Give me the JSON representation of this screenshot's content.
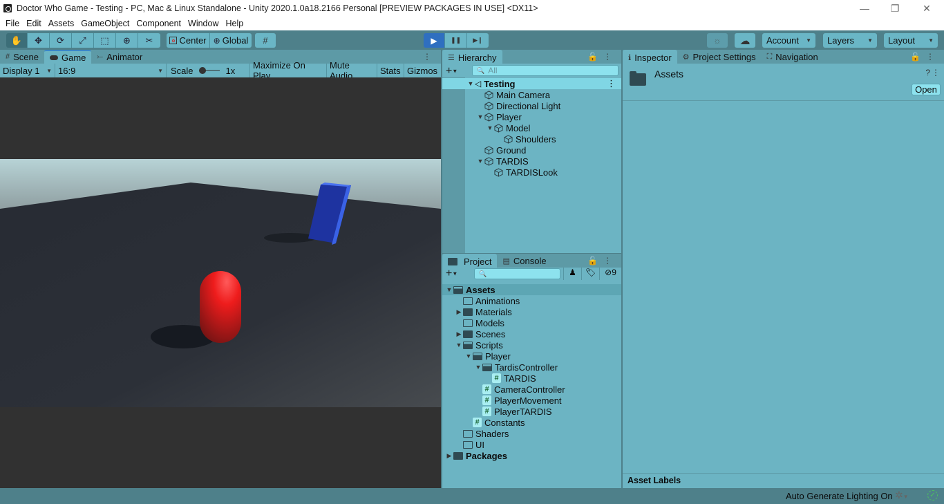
{
  "window": {
    "title": "Doctor Who Game - Testing - PC, Mac & Linux Standalone - Unity 2020.1.0a18.2166 Personal [PREVIEW PACKAGES IN USE] <DX11>",
    "controls": {
      "minimize": "—",
      "restore": "❐",
      "close": "✕"
    }
  },
  "menu": [
    "File",
    "Edit",
    "Assets",
    "GameObject",
    "Component",
    "Window",
    "Help"
  ],
  "toolbar": {
    "tools": [
      {
        "name": "hand-tool",
        "glyph": "✋"
      },
      {
        "name": "move-tool",
        "glyph": "✥"
      },
      {
        "name": "rotate-tool",
        "glyph": "⟳"
      },
      {
        "name": "scale-tool",
        "glyph": "⤢"
      },
      {
        "name": "rect-tool",
        "glyph": "⬚"
      },
      {
        "name": "transform-tool",
        "glyph": "⊕"
      },
      {
        "name": "custom-tool",
        "glyph": "✂"
      }
    ],
    "pivot_mode": "Center",
    "pivot_rotation": "Global",
    "snap_glyph": "#",
    "play_glyph": "▶",
    "pause_glyph": "❚❚",
    "step_glyph": "▶❙",
    "collab_glyph": "☼",
    "cloud_glyph": "☁",
    "account": "Account",
    "layers": "Layers",
    "layout": "Layout"
  },
  "scene_panel": {
    "tabs": [
      {
        "label": "Scene",
        "glyph": "#"
      },
      {
        "label": "Game",
        "glyph": "🎮"
      },
      {
        "label": "Animator",
        "glyph": "⤚"
      }
    ],
    "active_tab": "Game",
    "display": "Display 1",
    "aspect": "16:9",
    "scale_label": "Scale",
    "scale_value": "1x",
    "maximize_on_play": "Maximize On Play",
    "mute_audio": "Mute Audio",
    "stats": "Stats",
    "gizmos": "Gizmos"
  },
  "hierarchy": {
    "tab": "Hierarchy",
    "search_placeholder": "All",
    "scene": "Testing",
    "items": [
      {
        "label": "Main Camera",
        "depth": 1,
        "expanded": null
      },
      {
        "label": "Directional Light",
        "depth": 1,
        "expanded": null
      },
      {
        "label": "Player",
        "depth": 1,
        "expanded": true
      },
      {
        "label": "Model",
        "depth": 2,
        "expanded": true
      },
      {
        "label": "Shoulders",
        "depth": 3,
        "expanded": null
      },
      {
        "label": "Ground",
        "depth": 1,
        "expanded": null
      },
      {
        "label": "TARDIS",
        "depth": 1,
        "expanded": true
      },
      {
        "label": "TARDISLook",
        "depth": 2,
        "expanded": null
      }
    ]
  },
  "project": {
    "tabs": [
      "Project",
      "Console"
    ],
    "active_tab": "Project",
    "hidden_count": "9",
    "items": [
      {
        "label": "Assets",
        "depth": 0,
        "type": "folder-open",
        "expanded": true,
        "bold": true
      },
      {
        "label": "Animations",
        "depth": 1,
        "type": "folder-empty",
        "expanded": null
      },
      {
        "label": "Materials",
        "depth": 1,
        "type": "folder",
        "expanded": false
      },
      {
        "label": "Models",
        "depth": 1,
        "type": "folder-empty",
        "expanded": null
      },
      {
        "label": "Scenes",
        "depth": 1,
        "type": "folder",
        "expanded": false
      },
      {
        "label": "Scripts",
        "depth": 1,
        "type": "folder-open",
        "expanded": true
      },
      {
        "label": "Player",
        "depth": 2,
        "type": "folder-open",
        "expanded": true
      },
      {
        "label": "TardisController",
        "depth": 3,
        "type": "folder-open",
        "expanded": true
      },
      {
        "label": "TARDIS",
        "depth": 4,
        "type": "script",
        "expanded": null
      },
      {
        "label": "CameraController",
        "depth": 3,
        "type": "script",
        "expanded": null
      },
      {
        "label": "PlayerMovement",
        "depth": 3,
        "type": "script",
        "expanded": null
      },
      {
        "label": "PlayerTARDIS",
        "depth": 3,
        "type": "script",
        "expanded": null
      },
      {
        "label": "Constants",
        "depth": 2,
        "type": "script",
        "expanded": null
      },
      {
        "label": "Shaders",
        "depth": 1,
        "type": "folder-empty",
        "expanded": null
      },
      {
        "label": "UI",
        "depth": 1,
        "type": "folder-empty",
        "expanded": null
      },
      {
        "label": "Packages",
        "depth": 0,
        "type": "folder",
        "expanded": false,
        "bold": true
      }
    ]
  },
  "inspector": {
    "tabs": [
      {
        "label": "Inspector",
        "glyph": "ℹ"
      },
      {
        "label": "Project Settings",
        "glyph": "⚙"
      },
      {
        "label": "Navigation",
        "glyph": "⛶"
      }
    ],
    "active_tab": "Inspector",
    "asset_name": "Assets",
    "open_button": "Open",
    "asset_labels": "Asset Labels"
  },
  "status": {
    "lighting": "Auto Generate Lighting On"
  },
  "colors": {
    "accent": "#2f6fc0",
    "panel": "#6cb4c3",
    "chrome": "#4e808a",
    "player": "#e8191c",
    "tardis": "#2340b0"
  }
}
